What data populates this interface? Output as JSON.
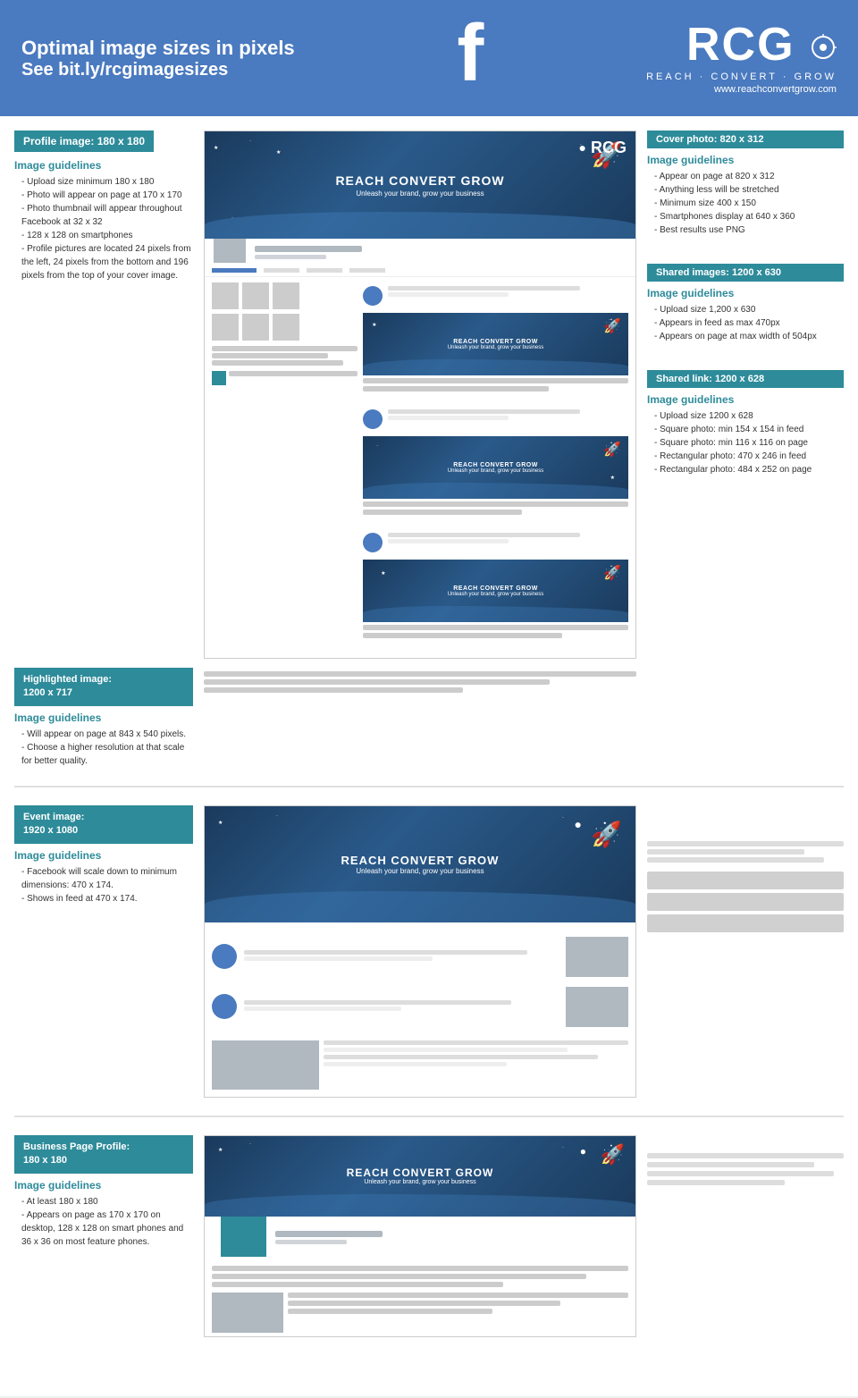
{
  "header": {
    "title_line1": "Optimal image sizes in pixels",
    "title_line2": "See bit.ly/rcgimagesizes",
    "facebook_symbol": "f",
    "logo": "RCG",
    "logo_tagline": "REACH · CONVERT · GROW",
    "logo_url": "www.reachconvertgrow.com"
  },
  "profile_image": {
    "label": "Profile image: 180 x 180",
    "guidelines_title": "Image guidelines",
    "guidelines": [
      "Upload size minimum 180 x 180",
      "Photo will appear on page at 170 x 170",
      "Photo thumbnail will appear throughout Facebook at 32 x 32",
      "128 x 128 on smartphones",
      "Profile pictures are located 24 pixels from the left, 24 pixels from the bottom and 196 pixels from the top of your cover image."
    ]
  },
  "cover_photo": {
    "label": "Cover photo: 820 x 312",
    "guidelines_title": "Image guidelines",
    "guidelines": [
      "Appear on page at 820 x 312",
      "Anything less will be stretched",
      "Minimum size 400 x 150",
      "Smartphones display at 640 x 360",
      "Best results use PNG"
    ]
  },
  "shared_images": {
    "label": "Shared images: 1200 x 630",
    "guidelines_title": "Image guidelines",
    "guidelines": [
      "Upload size 1,200 x 630",
      "Appears in feed as max 470px",
      "Appears on page at max width of 504px"
    ]
  },
  "shared_link": {
    "label": "Shared link: 1200 x 628",
    "guidelines_title": "Image guidelines",
    "guidelines": [
      "Upload size 1200 x 628",
      "Square photo: min 154 x 154 in feed",
      "Square photo: min 116 x 116 on page",
      "Rectangular photo: 470 x 246 in feed",
      "Rectangular photo: 484 x 252 on page"
    ]
  },
  "highlighted_image": {
    "label_line1": "Highlighted image:",
    "label_line2": "1200 x 717",
    "guidelines_title": "Image guidelines",
    "guidelines": [
      "Will appear on page at 843 x 540 pixels.",
      "Choose a higher resolution at that scale for better quality."
    ]
  },
  "event_image": {
    "label_line1": "Event image:",
    "label_line2": "1920 x 1080",
    "guidelines_title": "Image guidelines",
    "guidelines": [
      "Facebook will scale down to minimum dimensions: 470 x 174.",
      "Shows in feed at 470 x 174."
    ]
  },
  "business_profile": {
    "label_line1": "Business Page Profile:",
    "label_line2": "180 x 180",
    "guidelines_title": "Image guidelines",
    "guidelines": [
      "At least 180 x 180",
      "Appears on page as 170 x 170 on desktop, 128 x 128 on smart phones and 36 x 36 on most feature phones."
    ]
  },
  "mockup": {
    "brand_name": "REACH CONVERT GROW",
    "brand_tagline": "Unleash your brand, grow your business",
    "rcg_short": "RCG"
  }
}
